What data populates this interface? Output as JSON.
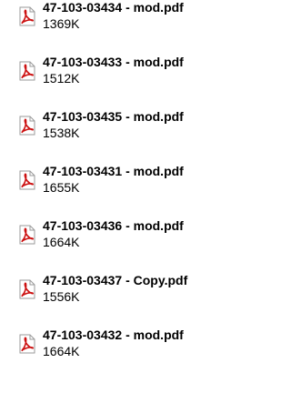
{
  "files": [
    {
      "name": "47-103-03434 - mod.pdf",
      "size": "1369K",
      "icon": "pdf-icon"
    },
    {
      "name": "47-103-03433 - mod.pdf",
      "size": "1512K",
      "icon": "pdf-icon"
    },
    {
      "name": "47-103-03435 - mod.pdf",
      "size": "1538K",
      "icon": "pdf-icon"
    },
    {
      "name": "47-103-03431 - mod.pdf",
      "size": "1655K",
      "icon": "pdf-icon"
    },
    {
      "name": "47-103-03436 - mod.pdf",
      "size": "1664K",
      "icon": "pdf-icon"
    },
    {
      "name": "47-103-03437 - Copy.pdf",
      "size": "1556K",
      "icon": "pdf-icon"
    },
    {
      "name": "47-103-03432 - mod.pdf",
      "size": "1664K",
      "icon": "pdf-icon"
    }
  ],
  "colors": {
    "icon_red": "#cc1111",
    "icon_page": "#ffffff",
    "icon_border": "#9a9a9a"
  }
}
